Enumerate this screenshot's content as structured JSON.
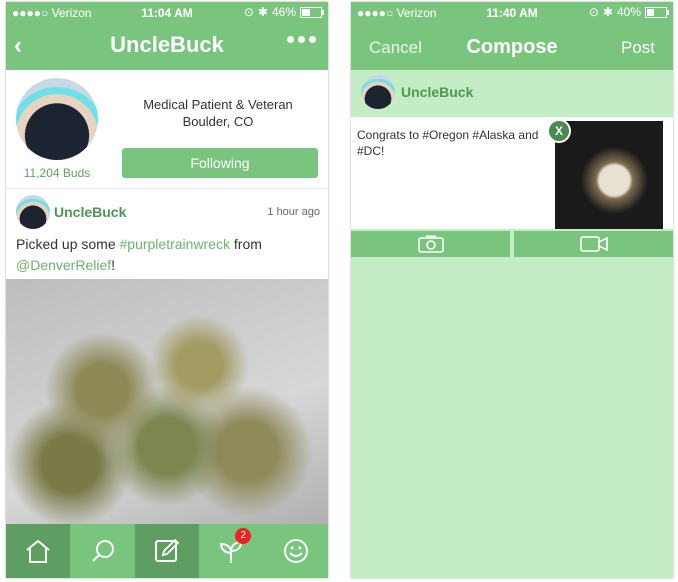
{
  "left": {
    "status": {
      "carrier": "●●●●○ Verizon",
      "time": "11:04 AM",
      "battery": "46%",
      "battery_level": 0.46
    },
    "nav": {
      "title": "UncleBuck"
    },
    "profile": {
      "buds": "11,204 Buds",
      "bio_line1": "Medical Patient & Veteran",
      "bio_line2": "Boulder, CO",
      "follow_label": "Following"
    },
    "post": {
      "name": "UncleBuck",
      "time": "1 hour ago",
      "text_prefix": "Picked up some ",
      "hashtag": "#purpletrainwreck",
      "text_mid": " from",
      "mention": "@DenverRelief",
      "text_suffix": "!"
    },
    "tabbar": {
      "badge": "2"
    }
  },
  "right": {
    "status": {
      "carrier": "●●●●○ Verizon",
      "time": "11:40 AM",
      "battery": "40%",
      "battery_level": 0.4
    },
    "nav": {
      "cancel": "Cancel",
      "title": "Compose",
      "post": "Post"
    },
    "user": {
      "name": "UncleBuck"
    },
    "compose": {
      "text": "Congrats to #Oregon #Alaska and #DC!",
      "remove": "X"
    }
  },
  "colors": {
    "accent": "#7ac57e",
    "accent_dark": "#5f9e63",
    "compose_bg": "#c4edc5",
    "link": "#6ab46e",
    "badge": "#ee2222"
  }
}
